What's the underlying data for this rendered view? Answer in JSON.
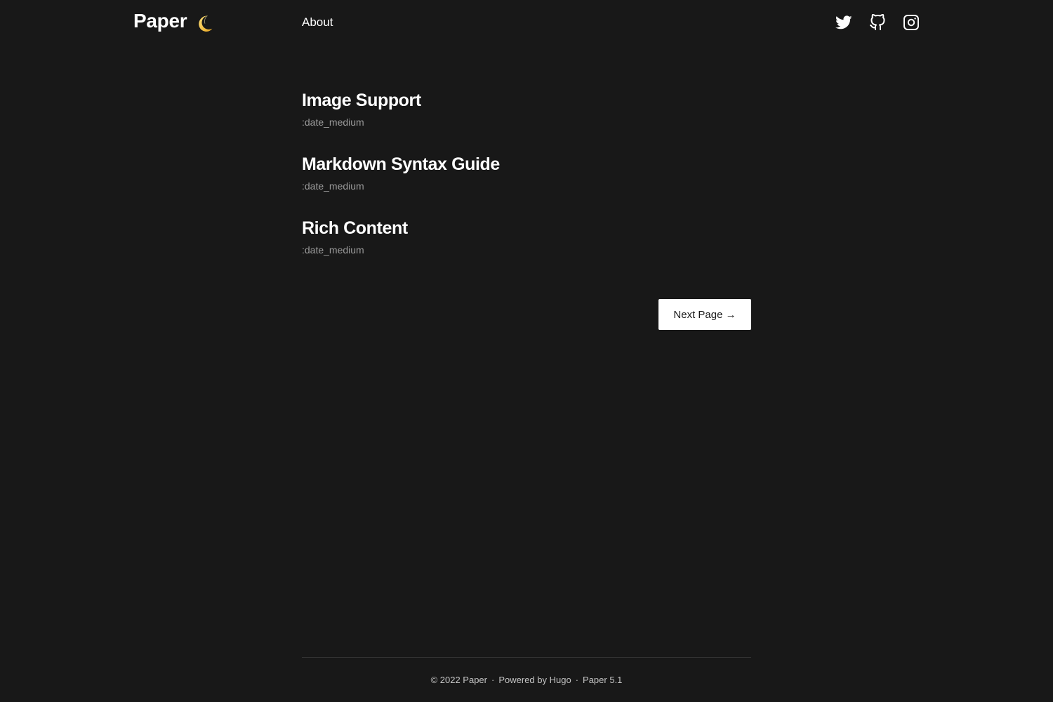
{
  "header": {
    "logo": "Paper",
    "theme_icon": "moon-icon",
    "nav": [
      {
        "label": "About"
      }
    ],
    "social": [
      {
        "icon": "twitter-icon"
      },
      {
        "icon": "github-icon"
      },
      {
        "icon": "instagram-icon"
      }
    ]
  },
  "posts": [
    {
      "title": "Image Support",
      "date": ":date_medium"
    },
    {
      "title": "Markdown Syntax Guide",
      "date": ":date_medium"
    },
    {
      "title": "Rich Content",
      "date": ":date_medium"
    }
  ],
  "pagination": {
    "next_label": "Next Page →"
  },
  "footer": {
    "copyright": "© 2022 Paper",
    "separator": "·",
    "powered_by": "Powered by Hugo",
    "theme": "Paper 5.1"
  },
  "colors": {
    "background": "#181818",
    "text": "#ffffff",
    "muted": "#9b9b9b",
    "moon": "#f5c542"
  }
}
